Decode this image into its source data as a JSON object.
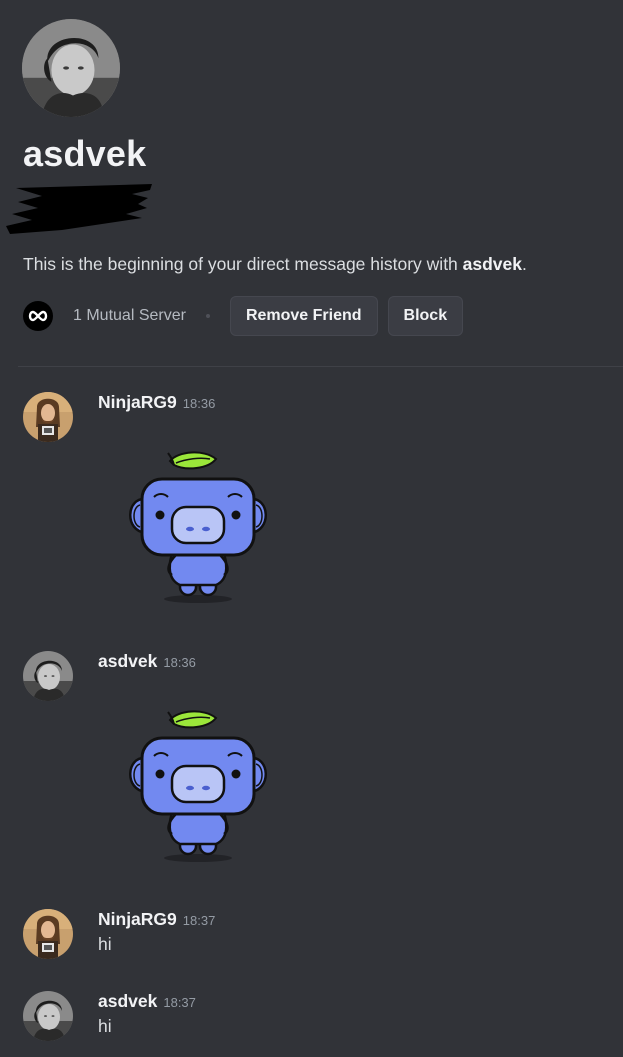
{
  "profile": {
    "username": "asdvek",
    "intro_prefix": "This is the beginning of your direct message history with ",
    "intro_name": "asdvek",
    "intro_suffix": ".",
    "mutual_servers": "1 Mutual Server",
    "remove_friend_label": "Remove Friend",
    "block_label": "Block"
  },
  "messages": [
    {
      "author": "NinjaRG9",
      "time": "18:36",
      "type": "sticker",
      "sticker": "wumpus-sticker"
    },
    {
      "author": "asdvek",
      "time": "18:36",
      "type": "sticker",
      "sticker": "wumpus-sticker"
    },
    {
      "author": "NinjaRG9",
      "time": "18:37",
      "type": "text",
      "text": "hi"
    },
    {
      "author": "asdvek",
      "time": "18:37",
      "type": "text",
      "text": "hi"
    }
  ],
  "colors": {
    "background": "#313338",
    "wumpus": "#7289f0",
    "leaf": "#9be63a"
  }
}
